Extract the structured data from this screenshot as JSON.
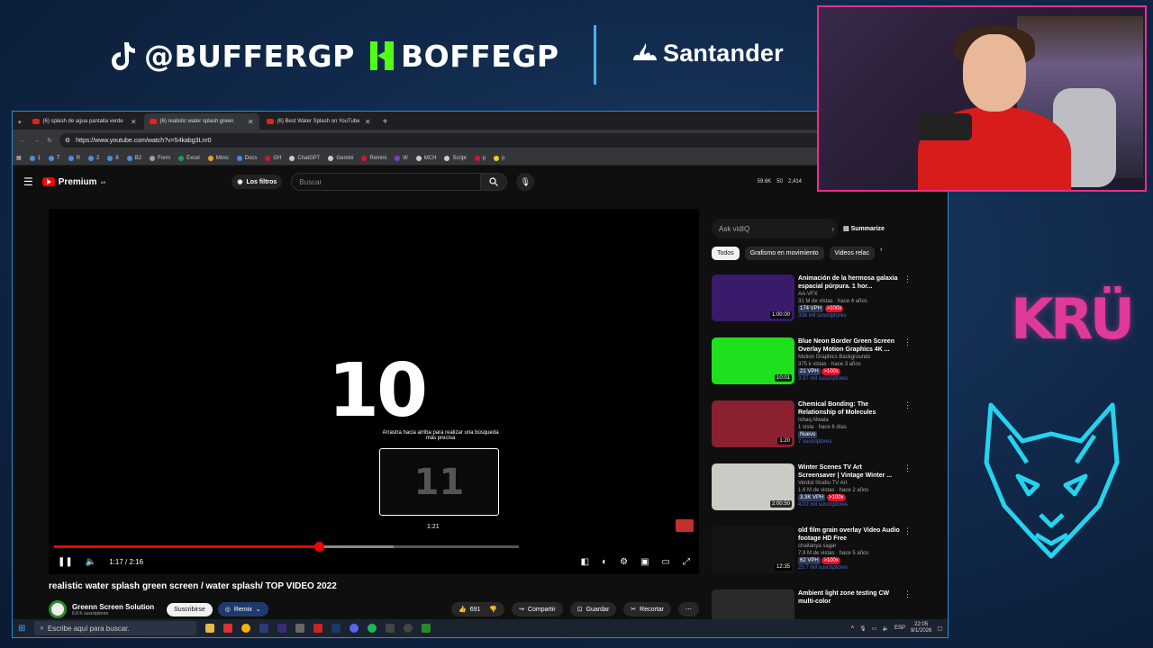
{
  "overlay": {
    "tiktok_handle": "@BUFFERGP",
    "kick_handle": "BOFFEGP",
    "sponsor": "Santander",
    "team_logo_text": "KRÜ",
    "colors": {
      "accent_pink": "#e82f8f",
      "accent_cyan": "#3fb6e8",
      "kick_green": "#53fc18"
    }
  },
  "browser": {
    "tabs": [
      {
        "label": "(6) splash de agua pantalla verde",
        "active": false
      },
      {
        "label": "(6) realistic water splash green",
        "active": true
      },
      {
        "label": "(6) Best Water Splash on YouTube",
        "active": false
      }
    ],
    "url": "https://www.youtube.com/watch?v=54kabg3Lnr0",
    "bookmarks": [
      "1",
      "T",
      "R",
      "2",
      "8",
      "B2",
      "Form",
      "Excel",
      "Minis",
      "Docs",
      "GH",
      "ChatGPT",
      "Gemini",
      "Remini",
      "W",
      "MCH",
      "Script",
      "p",
      "p"
    ]
  },
  "youtube": {
    "brand": "Premium",
    "brand_sup": "AR",
    "filter_chip": "Los filtros",
    "search_placeholder": "Buscar",
    "header_stats": [
      "59.6K",
      "50",
      "2,414"
    ],
    "player": {
      "frame_number": "10",
      "drag_hint": "Arrastra hacia arriba para realizar una búsqueda más precisa",
      "preview_number": "11",
      "preview_time": "1:21",
      "time_display": "1:17 / 2:16",
      "progress_fraction": 0.57,
      "buffered_fraction": 0.73
    },
    "video": {
      "title": "realistic water splash green screen / water splash/ TOP VIDEO 2022",
      "channel": "Greenn Screen Solution",
      "subscribers": "6.8 K suscriptores",
      "subscribe_label": "Suscribirse",
      "remix_label": "Remix",
      "likes": "691",
      "share_label": "Compartir",
      "save_label": "Guardar",
      "clip_label": "Recortar"
    },
    "sidebar": {
      "ask_placeholder": "Ask vidIQ",
      "summarize_label": "Summarize",
      "chips": [
        "Todos",
        "Grafismo en movimiento",
        "Videos relac"
      ],
      "recommendations": [
        {
          "title": "Animación de la hermosa galaxia espacial púrpura. 1 hor...",
          "channel": "AA-VFX",
          "meta": "31 M de vistas · hace 4 años",
          "vph": "174 VPH",
          "badge": ">100x",
          "subs": "338 mil suscriptores",
          "duration": "1:00:00",
          "color": "#3a1a6a"
        },
        {
          "title": "Blue Neon Border Green Screen Overlay Motion Graphics 4K ...",
          "channel": "Motion Graphics Backgrounds",
          "meta": "375 k vistas · hace 3 años",
          "vph": "21 VPH",
          "badge": ">100x",
          "subs": "3.37 mil suscriptores",
          "duration": "10:01",
          "color": "#1ee01e"
        },
        {
          "title": "Chemical Bonding: The Relationship of Molecules",
          "channel": "Ishaq Alwala",
          "meta": "1 vista · hace 6 días",
          "vph": "Nuevo",
          "badge": "",
          "subs": "7 suscriptores",
          "duration": "1:20",
          "color": "#8a2030"
        },
        {
          "title": "Winter Scenes TV Art Screensaver | Vintage Winter ...",
          "channel": "Verdot Studio TV Art",
          "meta": "1.6 M de vistas · hace 2 años",
          "vph": "3.3K VPH",
          "badge": ">100x",
          "subs": "4.02 mil suscriptores",
          "duration": "2:00:50",
          "color": "#c9ccc4"
        },
        {
          "title": "old film grain overlay  Video Audio footage HD Free",
          "channel": "chaitanya sagar",
          "meta": "7.9 M de vistas · hace 5 años",
          "vph": "62 VPH",
          "badge": ">100x",
          "subs": "23.7 mil suscriptores",
          "duration": "12:35",
          "color": "#141414"
        },
        {
          "title": "Ambient light zone testing CW multi-color",
          "channel": "",
          "meta": "",
          "vph": "",
          "badge": "",
          "subs": "",
          "duration": "",
          "color": "#2a2a2a"
        }
      ]
    }
  },
  "taskbar": {
    "search_placeholder": "Escribe aquí para buscar.",
    "lang": "ESP",
    "time": "22:05",
    "date": "9/1/2026"
  }
}
